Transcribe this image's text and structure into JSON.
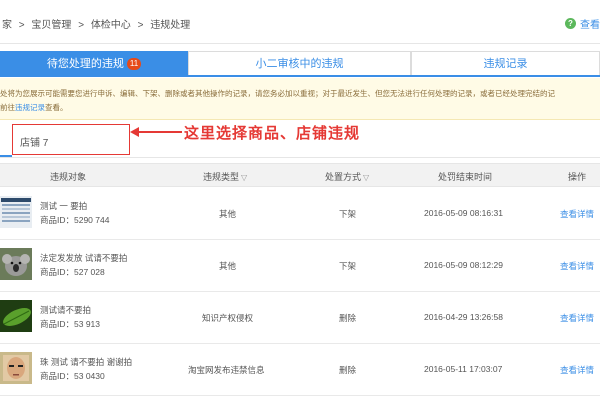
{
  "breadcrumb": {
    "items": [
      "家",
      ">",
      "宝贝管理",
      ">",
      "体检中心",
      ">",
      "违规处理"
    ]
  },
  "help": {
    "icon": "help-icon",
    "label": "查看"
  },
  "tabs": [
    {
      "label": "待您处理的违规",
      "badge": "11",
      "active": true
    },
    {
      "label": "小二审核中的违规",
      "active": false
    },
    {
      "label": "违规记录",
      "active": false
    }
  ],
  "notice": {
    "line1": "处将为您展示可能需要您进行申诉、编辑、下架、删除或者其他操作的记录，请您务必加以重视；对于最近发生、但您无法进行任何处理的记录，或者已经处理完结的记",
    "line2_prefix": "前往",
    "line2_link": "违规记录",
    "line2_suffix": "查看。"
  },
  "filter": {
    "shop_tab": "店铺 7"
  },
  "annotation": "这里选择商品、店铺违规",
  "table": {
    "headers": {
      "object": "违规对象",
      "type": "违规类型",
      "method": "处置方式",
      "end_time": "处罚结束时间",
      "action": "操作"
    },
    "rows": [
      {
        "title": "测试 一 要拍",
        "product_id": "商品ID：5290 744",
        "type": "其他",
        "method": "下架",
        "time": "2016-05-09 08:16:31",
        "action": "查看详情",
        "thumb": "screenshot-thumbnail"
      },
      {
        "title": "法定发发放 试请不要拍",
        "product_id": "商品ID：527 028",
        "type": "其他",
        "method": "下架",
        "time": "2016-05-09 08:12:29",
        "action": "查看详情",
        "thumb": "koala-thumbnail"
      },
      {
        "title": "测试请不要拍",
        "product_id": "商品ID：53 913",
        "type": "知识产权侵权",
        "method": "删除",
        "time": "2016-04-29 13:26:58",
        "action": "查看详情",
        "thumb": "leaf-thumbnail"
      },
      {
        "title": "珠 测试 请不要拍 谢谢拍",
        "product_id": "商品ID：53 0430",
        "type": "淘宝网发布违禁信息",
        "method": "删除",
        "time": "2016-05-11 17:03:07",
        "action": "查看详情",
        "thumb": "portrait-thumbnail"
      }
    ]
  },
  "colors": {
    "accent": "#3a8ee6",
    "badge": "#e64a19",
    "annotation": "#e53935",
    "notice_bg": "#fffbe6"
  }
}
